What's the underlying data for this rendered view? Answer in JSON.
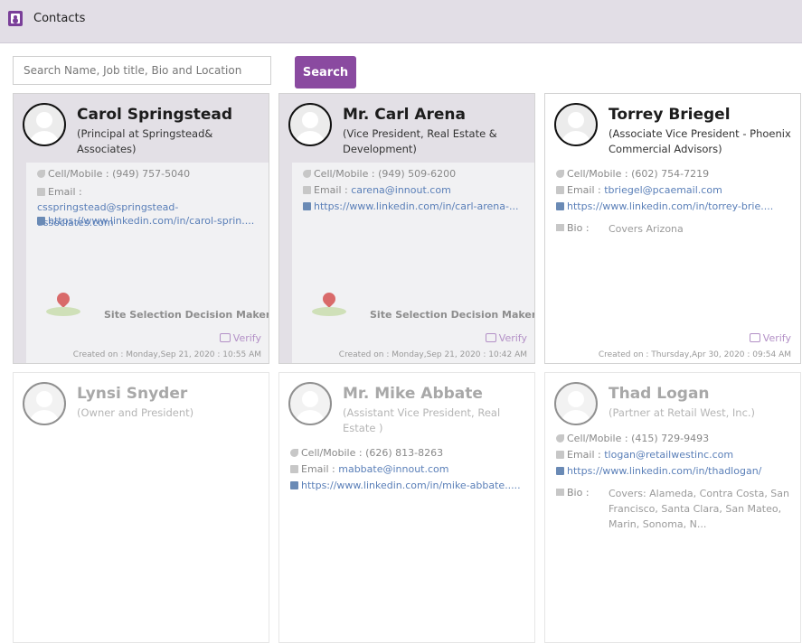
{
  "app": {
    "title": "Contacts",
    "icon": "address-book-icon"
  },
  "search": {
    "placeholder": "Search Name, Job title, Bio and Location",
    "value": "",
    "button_label": "Search"
  },
  "colors": {
    "accent": "#8a4aa0",
    "titlebar": "#e2dee6",
    "card_highlight": "#e3e0e6",
    "link": "#5a7fb8"
  },
  "labels": {
    "cell": "Cell/Mobile :",
    "email": "Email :",
    "bio": "Bio :",
    "verify": "Verify",
    "tagline": "Site Selection Decision Maker"
  },
  "contacts": [
    {
      "name": "Carol Springstead",
      "role": "(Principal at Springstead& Associates)",
      "phone": "(949) 757-5040",
      "email": "csspringstead@springstead-associates.com",
      "linkedin": "https://www.linkedin.com/in/carol-sprin....",
      "created": "Created on : Monday,Sep 21, 2020 : 10:55 AM"
    },
    {
      "name": "Mr. Carl Arena",
      "role": "(Vice President, Real Estate & Development)",
      "phone": "(949) 509-6200",
      "email": "carena@innout.com",
      "linkedin": "https://www.linkedin.com/in/carl-arena-...",
      "created": "Created on : Monday,Sep 21, 2020 : 10:42 AM"
    },
    {
      "name": "Torrey Briegel",
      "role": "(Associate Vice President - Phoenix Commercial Advisors)",
      "phone": "(602) 754-7219",
      "email": "tbriegel@pcaemail.com",
      "linkedin": "https://www.linkedin.com/in/torrey-brie....",
      "bio": "Covers Arizona",
      "created": "Created on : Thursday,Apr 30, 2020 : 09:54 AM"
    },
    {
      "name": "Lynsi Snyder",
      "role": "(Owner and President)"
    },
    {
      "name": "Mr. Mike Abbate",
      "role": "(Assistant Vice President, Real Estate )",
      "phone": "(626) 813-8263",
      "email": "mabbate@innout.com",
      "linkedin": "https://www.linkedin.com/in/mike-abbate....."
    },
    {
      "name": "Thad Logan",
      "role": "(Partner at Retail West, Inc.)",
      "phone": "(415) 729-9493",
      "email": "tlogan@retailwestinc.com",
      "linkedin": "https://www.linkedin.com/in/thadlogan/",
      "bio": "Covers: Alameda, Contra Costa, San Francisco, Santa Clara, San Mateo, Marin, Sonoma, N..."
    }
  ]
}
